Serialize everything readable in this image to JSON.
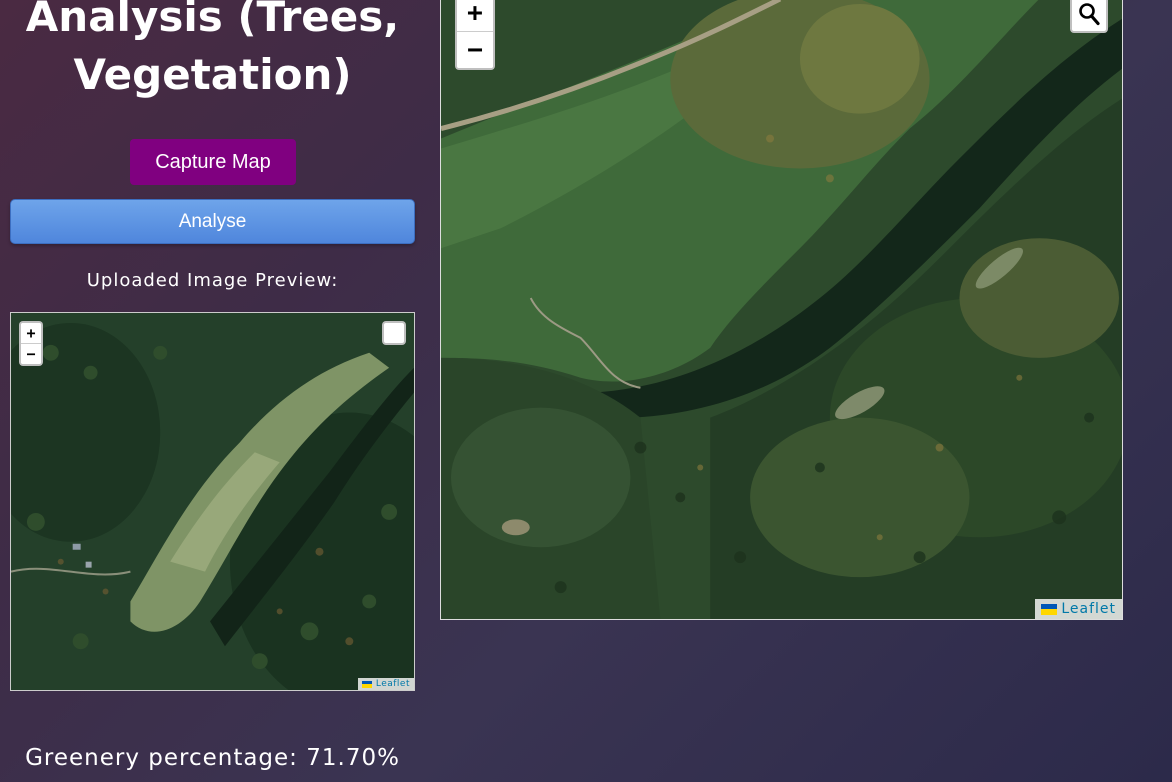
{
  "page": {
    "title": "Analysis (Trees, Vegetation)"
  },
  "buttons": {
    "capture_label": "Capture Map",
    "analyse_label": "Analyse"
  },
  "preview": {
    "label": "Uploaded Image Preview:"
  },
  "results": {
    "greenery_text": "Greenery percentage: 71.70%"
  },
  "map_controls": {
    "zoom_in": "+",
    "zoom_out": "−",
    "attribution": "Leaflet",
    "search_icon": "search-icon"
  },
  "colors": {
    "capture_button": "#800080",
    "analyse_button": "#4f86dc",
    "attribution_link": "#0078a8",
    "flag_blue": "#0057b7",
    "flag_yellow": "#ffd700"
  }
}
